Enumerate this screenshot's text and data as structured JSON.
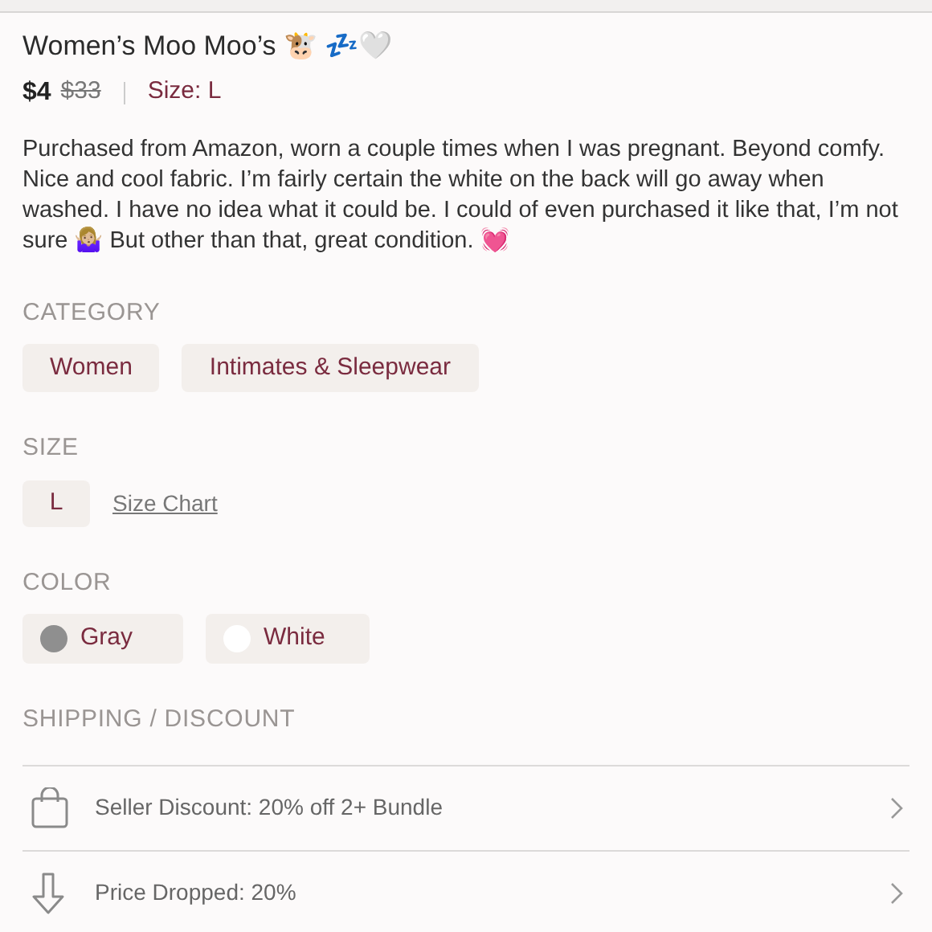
{
  "title": "Women’s Moo Moo’s 🐮 💤🤍",
  "price": "$4",
  "original_price": "$33",
  "size_label": "Size: L",
  "description": "Purchased from Amazon, worn a couple times when I was pregnant. Beyond comfy. Nice and cool fabric. I’m fairly certain the white on the back will go away when washed. I have no idea what it could be. I could of even purchased it like that, I’m not sure 🤷🏼‍♀️ But other than that, great condition. 💓",
  "category": {
    "heading": "CATEGORY",
    "chips": [
      "Women",
      "Intimates & Sleepwear"
    ]
  },
  "size": {
    "heading": "SIZE",
    "value": "L",
    "link": "Size Chart"
  },
  "color": {
    "heading": "COLOR",
    "options": [
      {
        "label": "Gray",
        "color": "#8f8f8f"
      },
      {
        "label": "White",
        "color": "#ffffff"
      }
    ]
  },
  "shipping": {
    "heading": "SHIPPING / DISCOUNT",
    "rows": [
      {
        "kind": "bag",
        "text": "Seller Discount: 20% off 2+ Bundle"
      },
      {
        "kind": "drop",
        "text": "Price Dropped: 20%"
      }
    ]
  }
}
